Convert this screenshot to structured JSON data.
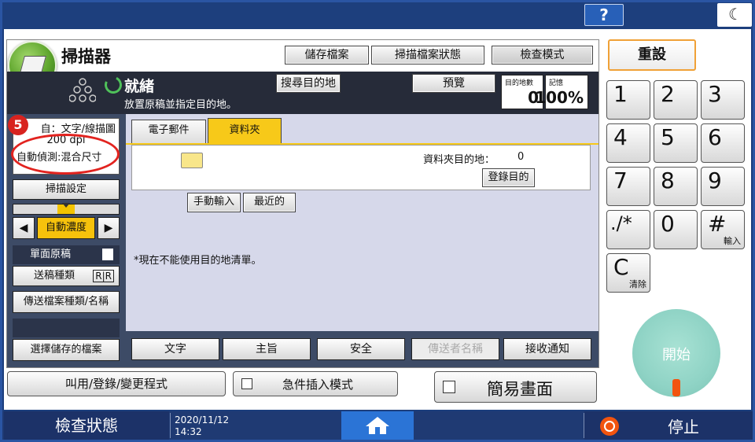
{
  "topbar": {
    "help_label": "?",
    "moon_icon": "moon-icon"
  },
  "app": {
    "title": "掃描器"
  },
  "header_buttons": {
    "save_file": "儲存檔案",
    "scan_status": "掃描檔案狀態",
    "check_mode": "檢查模式"
  },
  "status": {
    "state": "就緒",
    "message": "放置原稿並指定目的地。",
    "search_dest": "搜尋目的地",
    "preview": "預覽",
    "dest_count_label": "目的地數",
    "dest_count": "0",
    "memory_label": "記憶",
    "memory_value": "100%"
  },
  "scan_info": {
    "line1": "自：文字/線描圖",
    "line2": "200 dpi",
    "line3": "自動偵測:混合尺寸",
    "badge": "5"
  },
  "left_panel": {
    "scan_settings": "掃描設定",
    "auto_density": "自動濃度",
    "single_side": "單面原稿",
    "feed_type": "送稿種類",
    "file_type_name": "傳送檔案種類/名稱",
    "select_stored": "選擇儲存的檔案"
  },
  "tabs": [
    {
      "label": "電子郵件"
    },
    {
      "label": "資料夾"
    }
  ],
  "folder": {
    "dest_label": "資料夾目的地：",
    "dest_count": "0",
    "register_dest": "登錄目的"
  },
  "entry": {
    "manual": "手動輸入",
    "recent": "最近的"
  },
  "notice": "*現在不能使用目的地清單。",
  "bottom_tabs": {
    "text": "文字",
    "subject": "主旨",
    "security": "安全",
    "sender_name": "傳送者名稱",
    "receive_notice": "接收通知"
  },
  "program_bar": {
    "recall": "叫用/登錄/變更程式",
    "urgent_insert": "急件插入模式",
    "simple_screen": "簡易畫面"
  },
  "keypad": {
    "reset": "重設",
    "keys": [
      {
        "n": "1",
        "s": ""
      },
      {
        "n": "2",
        "s": ""
      },
      {
        "n": "3",
        "s": ""
      },
      {
        "n": "4",
        "s": ""
      },
      {
        "n": "5",
        "s": ""
      },
      {
        "n": "6",
        "s": ""
      },
      {
        "n": "7",
        "s": ""
      },
      {
        "n": "8",
        "s": ""
      },
      {
        "n": "9",
        "s": ""
      },
      {
        "n": "./*",
        "s": ""
      },
      {
        "n": "0",
        "s": ""
      },
      {
        "n": "#",
        "s": "輸入"
      },
      {
        "n": "C",
        "s": "清除"
      }
    ],
    "start": "開始"
  },
  "footer": {
    "check_status": "檢查狀態",
    "date": "2020/11/12",
    "time": "14:32",
    "stop": "停止"
  },
  "colors": {
    "accent_orange": "#f0a137",
    "ready_green": "#4fc15a",
    "start_teal": "#8fd3c5",
    "stop_red": "#f2540f"
  }
}
